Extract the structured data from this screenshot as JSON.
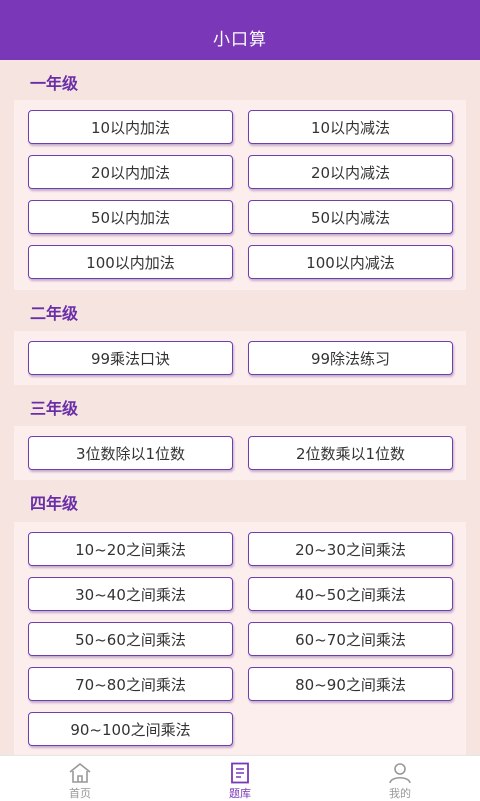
{
  "header": {
    "title": "小口算"
  },
  "grades": [
    {
      "title": "一年级",
      "items": [
        "10以内加法",
        "10以内减法",
        "20以内加法",
        "20以内减法",
        "50以内加法",
        "50以内减法",
        "100以内加法",
        "100以内减法"
      ]
    },
    {
      "title": "二年级",
      "items": [
        "99乘法口诀",
        "99除法练习"
      ]
    },
    {
      "title": "三年级",
      "items": [
        "3位数除以1位数",
        "2位数乘以1位数"
      ]
    },
    {
      "title": "四年级",
      "items": [
        "10~20之间乘法",
        "20~30之间乘法",
        "30~40之间乘法",
        "40~50之间乘法",
        "50~60之间乘法",
        "60~70之间乘法",
        "70~80之间乘法",
        "80~90之间乘法",
        "90~100之间乘法"
      ]
    }
  ],
  "tabbar": {
    "items": [
      {
        "label": "首页",
        "icon": "home-icon"
      },
      {
        "label": "题库",
        "icon": "question-bank-icon",
        "active": true
      },
      {
        "label": "我的",
        "icon": "user-icon"
      }
    ]
  },
  "colors": {
    "header": "#7a38b8",
    "accent": "#6a2fa8",
    "background": "#f6e4e0",
    "panel": "#fdeeee"
  }
}
